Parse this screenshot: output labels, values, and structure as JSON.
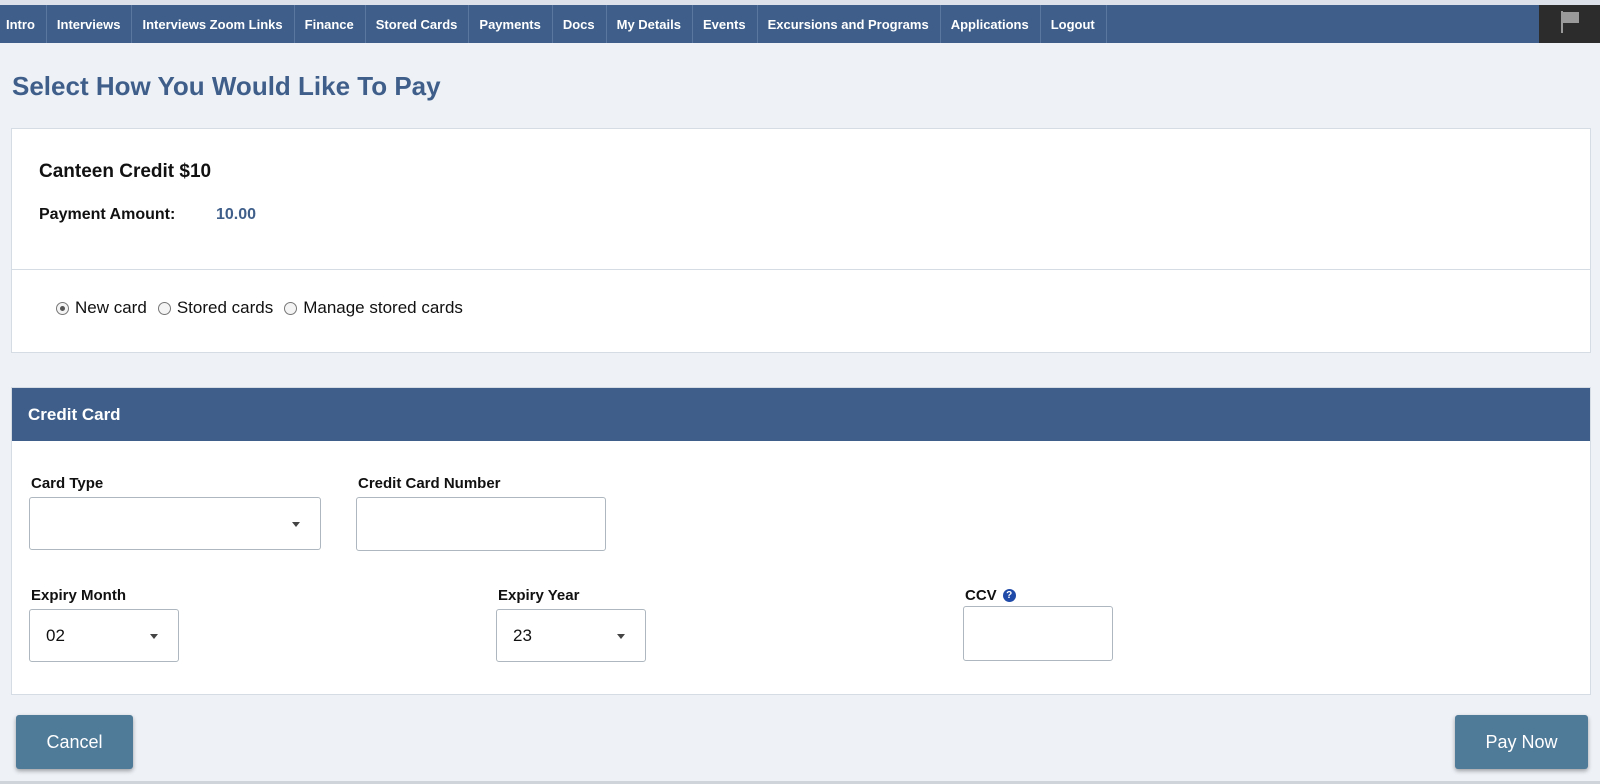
{
  "nav": {
    "items": [
      {
        "label": "Intro"
      },
      {
        "label": "Interviews"
      },
      {
        "label": "Interviews Zoom Links"
      },
      {
        "label": "Finance"
      },
      {
        "label": "Stored Cards"
      },
      {
        "label": "Payments"
      },
      {
        "label": "Docs"
      },
      {
        "label": "My Details"
      },
      {
        "label": "Events"
      },
      {
        "label": "Excursions and Programs"
      },
      {
        "label": "Applications"
      },
      {
        "label": "Logout"
      }
    ],
    "flag_icon": "flag-icon"
  },
  "page": {
    "title": "Select How You Would Like To Pay"
  },
  "summary": {
    "item_name": "Canteen Credit $10",
    "amount_label": "Payment Amount:",
    "amount_value": "10.00"
  },
  "payment_options": {
    "selected": "New card",
    "options": [
      {
        "label": "New card"
      },
      {
        "label": "Stored cards"
      },
      {
        "label": "Manage stored cards"
      }
    ]
  },
  "credit_card": {
    "header": "Credit Card",
    "card_type_label": "Card Type",
    "card_type_value": "",
    "card_number_label": "Credit Card Number",
    "card_number_value": "",
    "expiry_month_label": "Expiry Month",
    "expiry_month_value": "02",
    "expiry_year_label": "Expiry Year",
    "expiry_year_value": "23",
    "ccv_label": "CCV",
    "ccv_help_glyph": "?",
    "ccv_value": ""
  },
  "actions": {
    "cancel_label": "Cancel",
    "pay_label": "Pay Now"
  },
  "colors": {
    "nav_bg": "#3f5f8a",
    "title": "#3f5f8a",
    "button_bg": "#4f7a98",
    "page_bg": "#eef2f7"
  }
}
